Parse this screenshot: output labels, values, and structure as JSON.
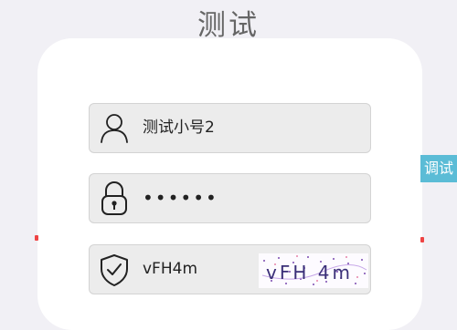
{
  "header": {
    "title": "测试"
  },
  "login_form": {
    "username": {
      "value": "测试小号2",
      "icon": "user-icon"
    },
    "password": {
      "value": "••••••",
      "icon": "lock-icon"
    },
    "captcha": {
      "value": "vFH4m",
      "icon": "shield-check-icon",
      "image_text": "vFH 4m"
    }
  },
  "debug_tab": {
    "label": "调试"
  },
  "colors": {
    "background": "#f1f0f5",
    "card": "#ffffff",
    "field": "#ececec",
    "debug_tab": "#5bbcd6"
  }
}
